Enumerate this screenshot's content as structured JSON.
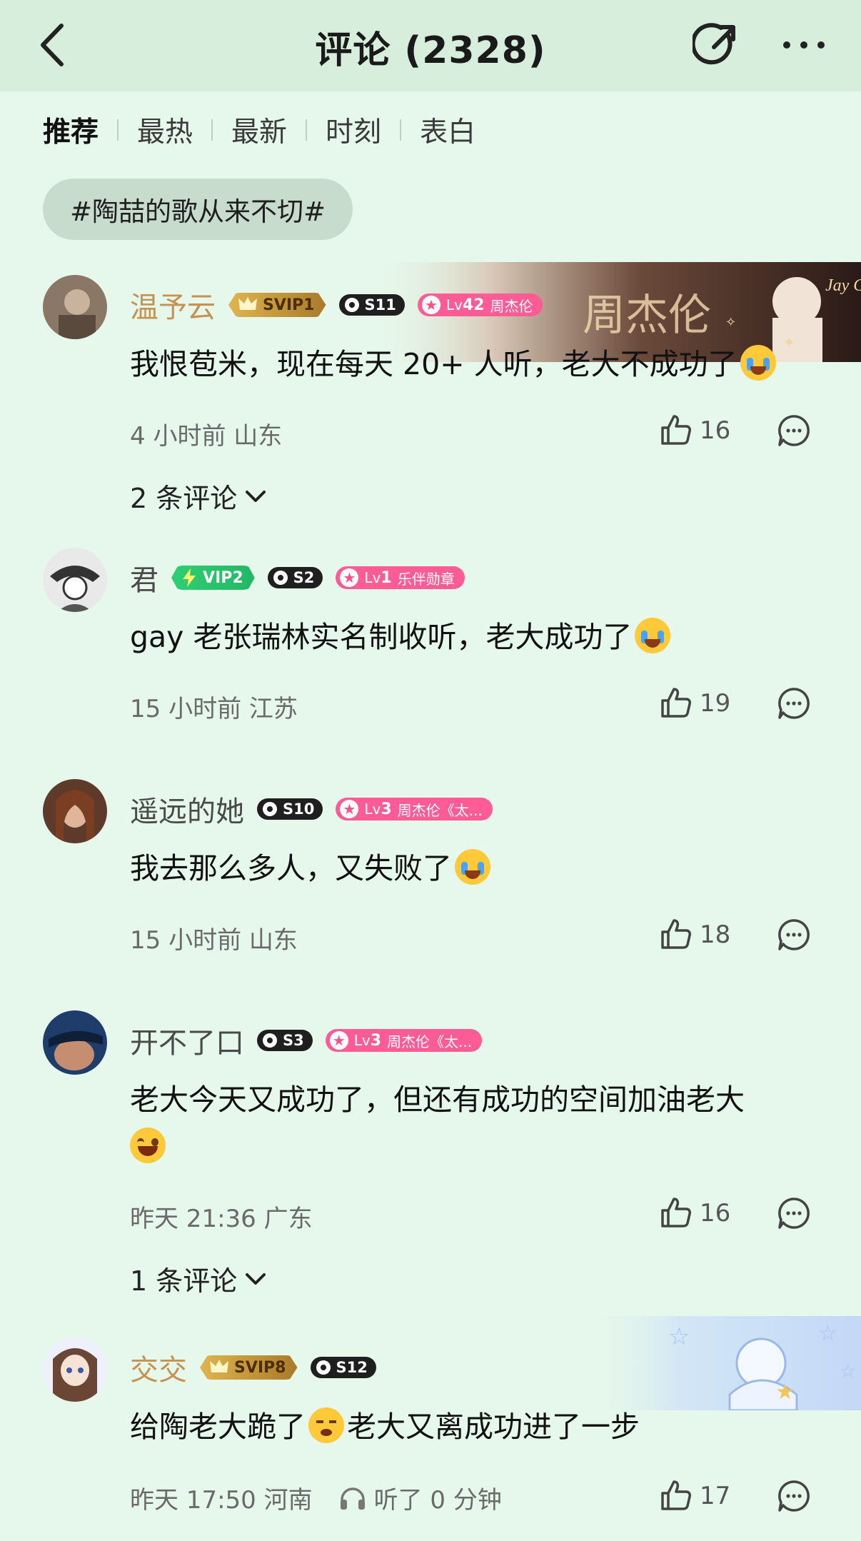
{
  "header": {
    "title": "评论 (2328)"
  },
  "tabs": [
    "推荐",
    "最热",
    "最新",
    "时刻",
    "表白"
  ],
  "topic": "#陶喆的歌从来不切#",
  "comments": [
    {
      "user": "温予云",
      "badges": {
        "svip": "SVIP1",
        "s": "S11",
        "lv": "42",
        "lv_text": "周杰伦"
      },
      "banner_text": "周杰伦",
      "banner_sub": "Jay Chou",
      "text": "我恨苞米，现在每天 20+ 人听，老大不成功了",
      "time": "4 小时前 山东",
      "likes": "16",
      "replies": "2 条评论"
    },
    {
      "user": "君",
      "badges": {
        "vip": "VIP2",
        "s": "S2",
        "lv": "1",
        "lv_text": "乐伴勋章"
      },
      "text": "gay 老张瑞林实名制收听，老大成功了",
      "time": "15 小时前 江苏",
      "likes": "19"
    },
    {
      "user": "遥远的她",
      "badges": {
        "s": "S10",
        "lv": "3",
        "lv_text": "周杰伦《太..."
      },
      "text": "我去那么多人，又失败了",
      "time": "15 小时前 山东",
      "likes": "18"
    },
    {
      "user": "开不了口",
      "badges": {
        "s": "S3",
        "lv": "3",
        "lv_text": "周杰伦《太..."
      },
      "text": "老大今天又成功了，但还有成功的空间加油老大",
      "time": "昨天 21:36 广东",
      "likes": "16",
      "replies": "1 条评论"
    },
    {
      "user": "交交",
      "badges": {
        "svip": "SVIP8",
        "s": "S12"
      },
      "text_a": "给陶老大跪了",
      "text_b": "老大又离成功进了一步",
      "time": "昨天 17:50 河南",
      "listen": "听了 0 分钟",
      "likes": "17"
    }
  ],
  "colors": {
    "background": "#e6f8eb",
    "header": "#d7eedd",
    "vip_name": "#c5924f",
    "lv_badge": "#ff5c96",
    "vip_badge": "#2fcf74"
  },
  "icons": [
    "back-icon",
    "share-icon",
    "more-icon",
    "like-icon",
    "reply-icon",
    "chevron-down-icon",
    "headphone-icon"
  ]
}
